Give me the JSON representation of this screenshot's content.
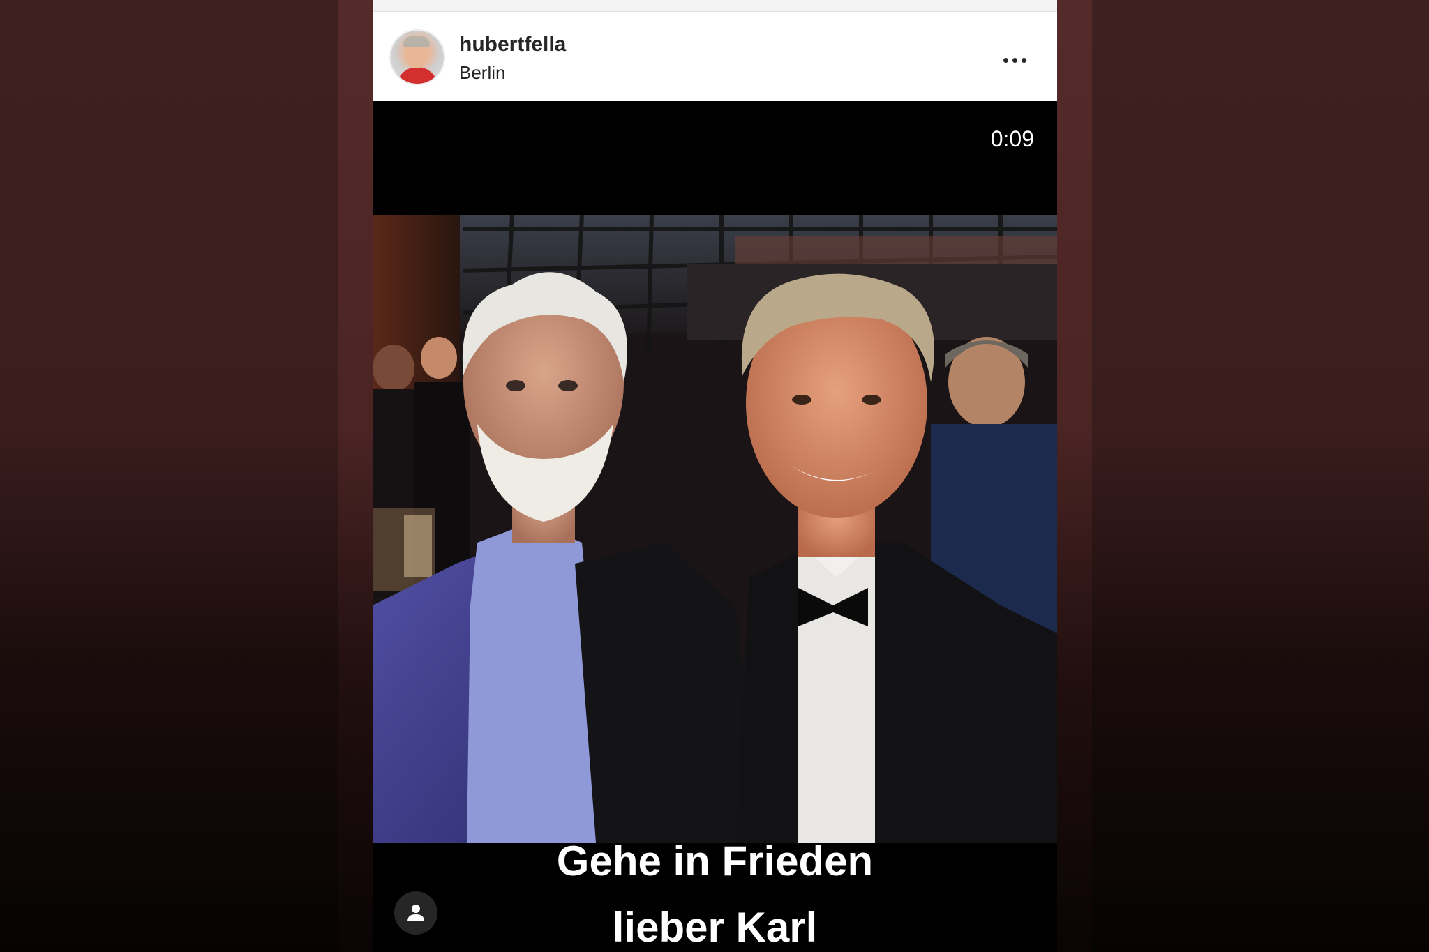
{
  "post": {
    "username": "hubertfella",
    "location": "Berlin",
    "more_icon": "more-horizontal-icon"
  },
  "video": {
    "elapsed": "0:09",
    "caption_line_1": "Gehe in Frieden",
    "caption_line_2": "lieber Karl",
    "tag_icon": "user-tag-icon"
  },
  "colors": {
    "header_bg": "#ffffff",
    "text": "#262626",
    "video_bg": "#000000",
    "backdrop": "#3f2020"
  }
}
